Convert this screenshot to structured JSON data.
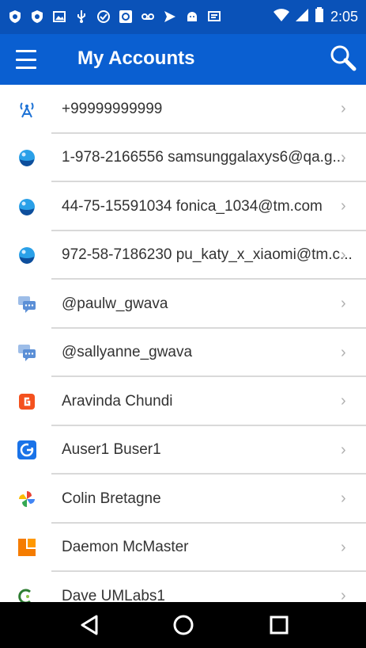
{
  "status_bar": {
    "time": "2:05",
    "icons": [
      "shield-icon",
      "shield-icon",
      "image-icon",
      "usb-icon",
      "check-circle-icon",
      "app-icon",
      "voicemail-icon",
      "send-icon",
      "android-icon",
      "message-icon",
      "wifi-icon",
      "signal-icon",
      "battery-icon"
    ]
  },
  "app_bar": {
    "title": "My Accounts",
    "menu_icon": "hamburger-menu-icon",
    "search_icon": "search-icon"
  },
  "accounts": [
    {
      "label": "+99999999999",
      "icon": "antenna-icon",
      "color": "#1e73d6"
    },
    {
      "label": "1-978-2166556 samsunggalaxys6@qa.g...",
      "icon": "bubble-icon",
      "color": "#2aa0e8"
    },
    {
      "label": "44-75-15591034 fonica_1034@tm.com",
      "icon": "bubble-icon",
      "color": "#2aa0e8"
    },
    {
      "label": "972-58-7186230 pu_katy_x_xiaomi@tm.c...",
      "icon": "bubble-icon",
      "color": "#2aa0e8"
    },
    {
      "label": "@paulw_gwava",
      "icon": "chat-icon",
      "color": "#7ea6e0"
    },
    {
      "label": "@sallyanne_gwava",
      "icon": "chat-icon",
      "color": "#7ea6e0"
    },
    {
      "label": "Aravinda Chundi",
      "icon": "app-g-icon",
      "color": "#f4511e"
    },
    {
      "label": "Auser1 Buser1",
      "icon": "g-circle-icon",
      "color": "#1a73e8"
    },
    {
      "label": "Colin Bretagne",
      "icon": "pinwheel-icon",
      "color": "#34a853"
    },
    {
      "label": "Daemon McMaster",
      "icon": "l-block-icon",
      "color": "#f57c00"
    },
    {
      "label": "Dave UMLabs1",
      "icon": "leaf-icon",
      "color": "#2e7d32"
    }
  ],
  "chevron": "›",
  "nav_bar": {
    "back_icon": "back-triangle-icon",
    "home_icon": "home-circle-icon",
    "recents_icon": "recents-square-icon"
  }
}
